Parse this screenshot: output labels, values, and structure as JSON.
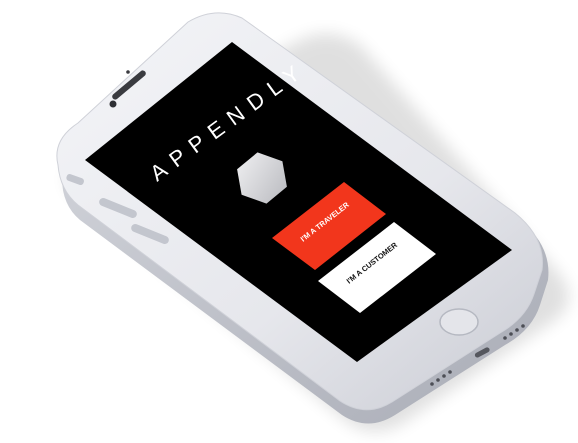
{
  "app": {
    "brand_title": "APPENDLY",
    "logo_icon": "hexagon-icon"
  },
  "buttons": {
    "traveler_label": "I'M A TRAVELER",
    "customer_label": "I'M A CUSTOMER"
  },
  "colors": {
    "screen_background": "#000000",
    "traveler_button": "#f2361c",
    "customer_button": "#ffffff",
    "phone_body": "#e8e9ee",
    "logo": "#d9d9dc"
  }
}
